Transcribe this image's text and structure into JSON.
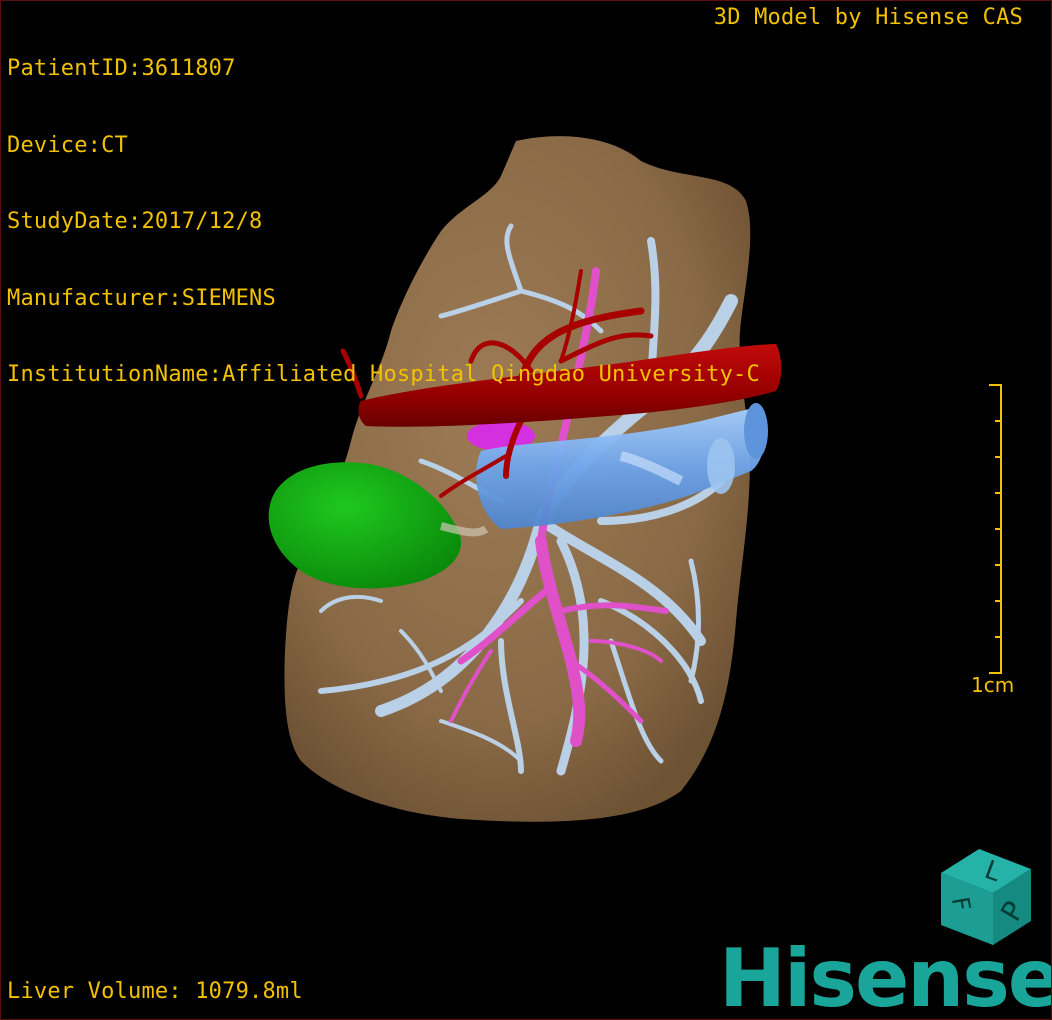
{
  "meta": {
    "patient_id": "PatientID:3611807",
    "device": "Device:CT",
    "study_date": "StudyDate:2017/12/8",
    "manufacturer": "Manufacturer:SIEMENS",
    "institution": "InstitutionName:Affiliated Hospital Qingdao University-C"
  },
  "credit": "3D Model by Hisense CAS",
  "volume": "Liver Volume: 1079.8ml",
  "scale": {
    "label": "1cm"
  },
  "orientation": {
    "face_top": "L",
    "face_side": "P",
    "face_left": "F"
  },
  "logo": "Hisense",
  "colors": {
    "text": "#f2c100",
    "liver": "#8e6e4a",
    "hepatic_vein": "#b9d0e6",
    "portal_vein": "#e050c8",
    "artery": "#a80000",
    "ivc": "#78b0f0",
    "gallbladder": "#17a817",
    "brand": "#1aa59a"
  }
}
